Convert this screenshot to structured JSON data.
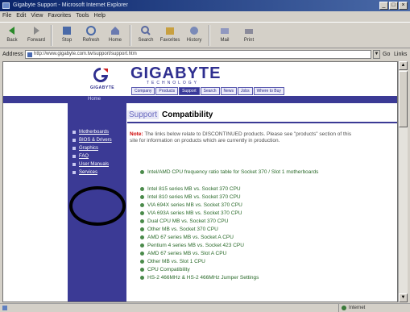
{
  "window": {
    "title": "Gigabyte Support - Microsoft Internet Explorer"
  },
  "menu": [
    "File",
    "Edit",
    "View",
    "Favorites",
    "Tools",
    "Help"
  ],
  "toolbar": [
    {
      "label": "Back",
      "icon": "back-icon"
    },
    {
      "label": "Forward",
      "icon": "forward-icon"
    },
    {
      "label": "Stop",
      "icon": "stop-icon"
    },
    {
      "label": "Refresh",
      "icon": "refresh-icon"
    },
    {
      "label": "Home",
      "icon": "home-icon"
    },
    {
      "label": "Search",
      "icon": "search-icon"
    },
    {
      "label": "Favorites",
      "icon": "favorites-icon"
    },
    {
      "label": "History",
      "icon": "history-icon"
    },
    {
      "label": "Mail",
      "icon": "mail-icon"
    },
    {
      "label": "Print",
      "icon": "print-icon"
    }
  ],
  "address": {
    "label": "Address",
    "url": "http://www.gigabyte.com.tw/support/support.htm",
    "go": "Go",
    "links": "Links"
  },
  "site": {
    "logo_sub": "GIGABYTE",
    "brand": "GIGABYTE",
    "tagline": "TECHNOLOGY",
    "tabs": [
      "Company",
      "Products",
      "Support",
      "Search",
      "News",
      "Jobs",
      "Where to Buy"
    ],
    "home": "Home"
  },
  "sidebar": [
    "Motherboards",
    "BIOS & Drivers",
    "Graphics",
    "FAQ",
    "User Manuals",
    "Services"
  ],
  "section": {
    "label": "Support",
    "title": "Compatibility"
  },
  "notice": {
    "prefix": "Note:",
    "text": "The links below relate to DISCONTINUED products. Please see \"products\" section of this site for information on products which are currently in production."
  },
  "links": [
    "Intel/AMD CPU frequency ratio table for Socket 370 / Slot 1 motherboards",
    "Intel 815 series MB vs. Socket 370 CPU",
    "Intel 810 series MB vs. Socket 370 CPU",
    "VIA 694X series MB vs. Socket 370 CPU",
    "VIA 693A series MB vs. Socket 370 CPU",
    "Dual CPU MB vs. Socket 370 CPU",
    "Other MB vs. Socket 370 CPU",
    "AMD 67 series MB vs. Socket A CPU",
    "Pentium 4 series MB vs. Socket 423 CPU",
    "AMD 67 series MB vs. Slot A CPU",
    "Other MB vs. Slot 1 CPU",
    "CPU Compatibility",
    "HS-2 466MHz & HS-2 466MHz Jumper Settings"
  ],
  "status": {
    "zone": "Internet"
  }
}
